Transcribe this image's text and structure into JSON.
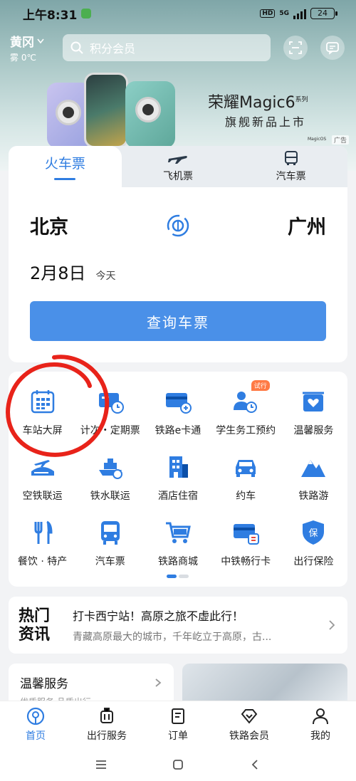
{
  "status_bar": {
    "time": "上午8:31",
    "hd": "HD",
    "network": "5G",
    "battery": "24"
  },
  "header": {
    "city": "黄冈",
    "weather": "雾 0℃",
    "search_placeholder": "积分会员"
  },
  "ad": {
    "title": "荣耀Magic6",
    "title_suffix": "系列",
    "subtitle": "旗舰新品上市",
    "os_label": "MagicOS",
    "tag": "广告"
  },
  "ticket": {
    "tabs": [
      {
        "label": "火车票",
        "active": true
      },
      {
        "label": "飞机票",
        "icon": "airplane-icon"
      },
      {
        "label": "汽车票",
        "icon": "bus-icon"
      }
    ],
    "from": "北京",
    "to": "广州",
    "date": "2月8日",
    "date_note": "今天",
    "query_button": "查询车票"
  },
  "services": [
    {
      "label": "车站大屏",
      "icon": "calendar-grid-icon"
    },
    {
      "label": "计次・定期票",
      "icon": "ticket-clock-icon"
    },
    {
      "label": "铁路e卡通",
      "icon": "card-icon"
    },
    {
      "label": "学生务工预约",
      "icon": "people-icon",
      "badge": "试行"
    },
    {
      "label": "温馨服务",
      "icon": "heart-box-icon"
    },
    {
      "label": "空铁联运",
      "icon": "train-plane-icon"
    },
    {
      "label": "铁水联运",
      "icon": "ship-icon"
    },
    {
      "label": "酒店住宿",
      "icon": "building-icon"
    },
    {
      "label": "约车",
      "icon": "car-icon"
    },
    {
      "label": "铁路游",
      "icon": "mountain-icon"
    },
    {
      "label": "餐饮 · 特产",
      "icon": "utensils-icon"
    },
    {
      "label": "汽车票",
      "icon": "bus-icon"
    },
    {
      "label": "铁路商城",
      "icon": "cart-icon"
    },
    {
      "label": "中铁畅行卡",
      "icon": "train-card-icon"
    },
    {
      "label": "出行保险",
      "icon": "shield-icon"
    }
  ],
  "news": {
    "logo_line1": "热门",
    "logo_line2": "资讯",
    "title": "打卡西宁站！高原之旅不虚此行！",
    "desc": "青藏高原最大的城市，千年屹立于高原，古..."
  },
  "warm_service": {
    "title": "温馨服务",
    "subtitle": "优质服务 品质出行"
  },
  "bottom_nav": [
    {
      "label": "首页",
      "active": true
    },
    {
      "label": "出行服务"
    },
    {
      "label": "订单"
    },
    {
      "label": "铁路会员"
    },
    {
      "label": "我的"
    }
  ],
  "colors": {
    "accent": "#2f7de1",
    "button": "#4a90e8",
    "annotation": "#e8231a"
  }
}
